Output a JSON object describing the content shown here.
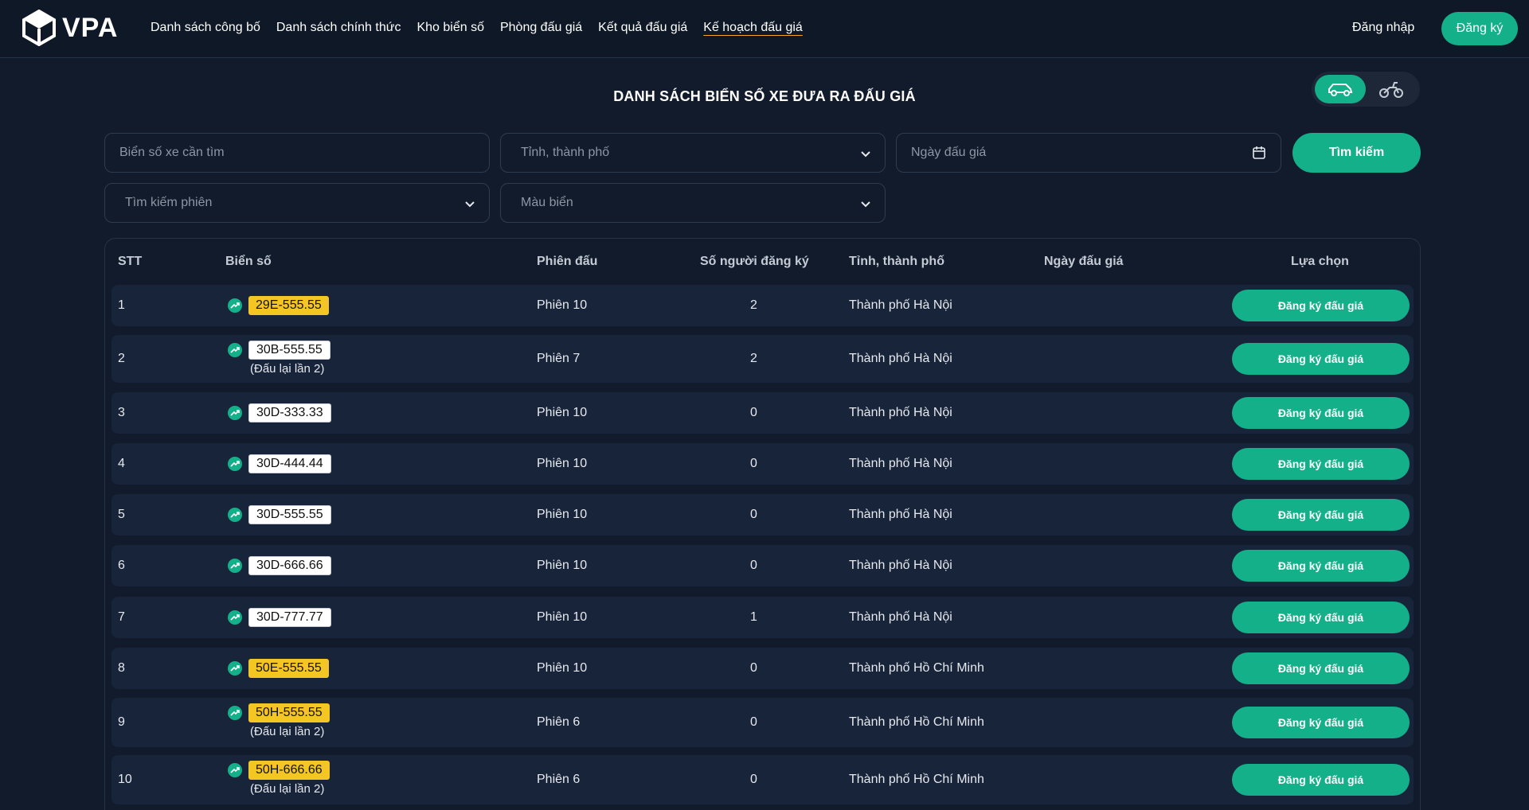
{
  "header": {
    "logo_text": "VPA",
    "nav": [
      {
        "label": "Danh sách công bố"
      },
      {
        "label": "Danh sách chính thức"
      },
      {
        "label": "Kho biển số"
      },
      {
        "label": "Phòng đấu giá"
      },
      {
        "label": "Kết quả đấu giá"
      },
      {
        "label": "Kế hoạch đấu giá",
        "active": true
      }
    ],
    "login_label": "Đăng nhập",
    "register_label": "Đăng ký"
  },
  "page": {
    "title": "DANH SÁCH BIỂN SỐ XE ĐƯA RA ĐẤU GIÁ",
    "vehicle_types": [
      "car-icon",
      "motorbike-icon"
    ],
    "active_vehicle": "car"
  },
  "filters": {
    "plate_placeholder": "Biển số xe cần tìm",
    "province_placeholder": "Tỉnh, thành phố",
    "date_placeholder": "Ngày đấu giá",
    "session_placeholder": "Tìm kiếm phiên",
    "color_placeholder": "Màu biển",
    "search_label": "Tìm kiếm"
  },
  "table": {
    "headers": {
      "stt": "STT",
      "plate": "Biển số",
      "session": "Phiên đấu",
      "registrants": "Số người đăng ký",
      "province": "Tỉnh, thành phố",
      "date": "Ngày đấu giá",
      "action": "Lựa chọn"
    },
    "action_label": "Đăng ký đấu giá",
    "rows": [
      {
        "stt": "1",
        "plate": "29E-555.55",
        "color": "yellow",
        "note": "",
        "session": "Phiên 10",
        "registrants": "2",
        "province": "Thành phố Hà Nội",
        "date": ""
      },
      {
        "stt": "2",
        "plate": "30B-555.55",
        "color": "white",
        "note": "(Đấu lại lần 2)",
        "session": "Phiên 7",
        "registrants": "2",
        "province": "Thành phố Hà Nội",
        "date": ""
      },
      {
        "stt": "3",
        "plate": "30D-333.33",
        "color": "white",
        "note": "",
        "session": "Phiên 10",
        "registrants": "0",
        "province": "Thành phố Hà Nội",
        "date": ""
      },
      {
        "stt": "4",
        "plate": "30D-444.44",
        "color": "white",
        "note": "",
        "session": "Phiên 10",
        "registrants": "0",
        "province": "Thành phố Hà Nội",
        "date": ""
      },
      {
        "stt": "5",
        "plate": "30D-555.55",
        "color": "white",
        "note": "",
        "session": "Phiên 10",
        "registrants": "0",
        "province": "Thành phố Hà Nội",
        "date": ""
      },
      {
        "stt": "6",
        "plate": "30D-666.66",
        "color": "white",
        "note": "",
        "session": "Phiên 10",
        "registrants": "0",
        "province": "Thành phố Hà Nội",
        "date": ""
      },
      {
        "stt": "7",
        "plate": "30D-777.77",
        "color": "white",
        "note": "",
        "session": "Phiên 10",
        "registrants": "1",
        "province": "Thành phố Hà Nội",
        "date": ""
      },
      {
        "stt": "8",
        "plate": "50E-555.55",
        "color": "yellow",
        "note": "",
        "session": "Phiên 10",
        "registrants": "0",
        "province": "Thành phố Hồ Chí Minh",
        "date": ""
      },
      {
        "stt": "9",
        "plate": "50H-555.55",
        "color": "yellow",
        "note": "(Đấu lại lần 2)",
        "session": "Phiên 6",
        "registrants": "0",
        "province": "Thành phố Hồ Chí Minh",
        "date": ""
      },
      {
        "stt": "10",
        "plate": "50H-666.66",
        "color": "yellow",
        "note": "(Đấu lại lần 2)",
        "session": "Phiên 6",
        "registrants": "0",
        "province": "Thành phố Hồ Chí Minh",
        "date": ""
      }
    ]
  },
  "colors": {
    "background": "#111b2b",
    "accent": "#14b08a",
    "plate_yellow": "#f3c623",
    "row_bg": "#18243a"
  }
}
